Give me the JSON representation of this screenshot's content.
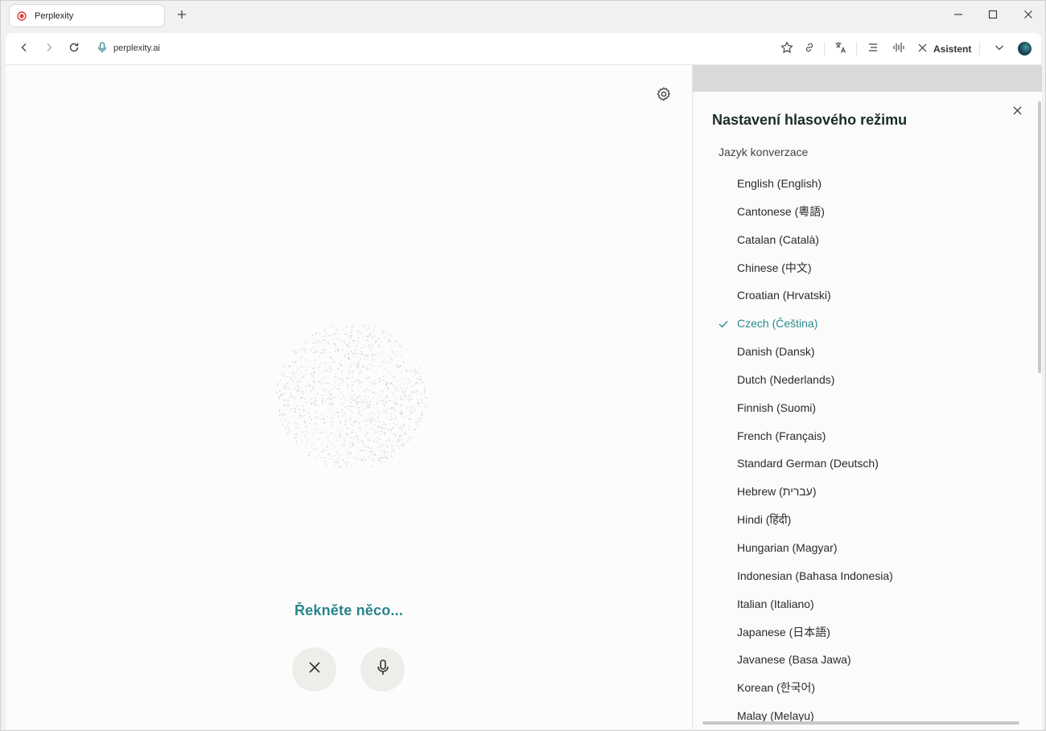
{
  "browser": {
    "tab_title": "Perplexity",
    "url": "perplexity.ai",
    "assistant_label": "Asistent",
    "accent_color": "#2a8c92"
  },
  "main": {
    "prompt": "Řekněte něco..."
  },
  "panel": {
    "title": "Nastavení hlasového režimu",
    "subtitle": "Jazyk konverzace",
    "languages": [
      {
        "label": "English (English)",
        "selected": false
      },
      {
        "label": "Cantonese (粵語)",
        "selected": false
      },
      {
        "label": "Catalan (Català)",
        "selected": false
      },
      {
        "label": "Chinese (中文)",
        "selected": false
      },
      {
        "label": "Croatian (Hrvatski)",
        "selected": false
      },
      {
        "label": "Czech (Čeština)",
        "selected": true
      },
      {
        "label": "Danish (Dansk)",
        "selected": false
      },
      {
        "label": "Dutch (Nederlands)",
        "selected": false
      },
      {
        "label": "Finnish (Suomi)",
        "selected": false
      },
      {
        "label": "French (Français)",
        "selected": false
      },
      {
        "label": "Standard German (Deutsch)",
        "selected": false
      },
      {
        "label": "Hebrew (עברית)",
        "selected": false
      },
      {
        "label": "Hindi (हिंदी)",
        "selected": false
      },
      {
        "label": "Hungarian (Magyar)",
        "selected": false
      },
      {
        "label": "Indonesian (Bahasa Indonesia)",
        "selected": false
      },
      {
        "label": "Italian (Italiano)",
        "selected": false
      },
      {
        "label": "Japanese (日本語)",
        "selected": false
      },
      {
        "label": "Javanese (Basa Jawa)",
        "selected": false
      },
      {
        "label": "Korean (한국어)",
        "selected": false
      },
      {
        "label": "Malay (Melayu)",
        "selected": false
      }
    ]
  },
  "icons": {
    "favicon": "perplexity-record-icon",
    "new_tab": "plus-icon",
    "minimize": "minimize-icon",
    "maximize": "maximize-icon",
    "close": "close-icon",
    "back": "chevron-left-icon",
    "forward": "chevron-right-icon",
    "reload": "reload-icon",
    "mic": "microphone-icon",
    "bookmark": "star-icon",
    "link": "link-icon",
    "translate": "translate-icon",
    "reader": "reader-mode-icon",
    "audio": "audio-wave-icon",
    "menu": "chevron-down-icon",
    "settings": "gear-icon"
  }
}
